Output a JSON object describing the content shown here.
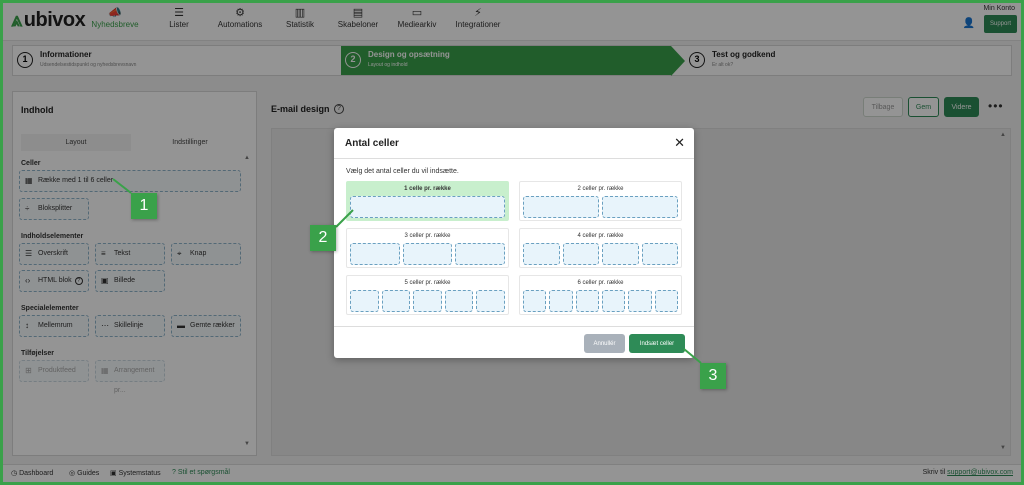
{
  "app": {
    "logo": "ubivox",
    "nav": [
      {
        "label": "Nyhedsbreve",
        "icon": "megaphone-icon",
        "glyph": "📣",
        "active": true
      },
      {
        "label": "Lister",
        "icon": "list-icon",
        "glyph": "☰",
        "active": false
      },
      {
        "label": "Automations",
        "icon": "gears-icon",
        "glyph": "⚙",
        "active": false
      },
      {
        "label": "Statistik",
        "icon": "bar-chart-icon",
        "glyph": "▥",
        "active": false
      },
      {
        "label": "Skabeloner",
        "icon": "templates-icon",
        "glyph": "▤",
        "active": false
      },
      {
        "label": "Mediearkiv",
        "icon": "media-icon",
        "glyph": "▭",
        "active": false
      },
      {
        "label": "Integrationer",
        "icon": "plug-icon",
        "glyph": "⚡",
        "active": false
      }
    ],
    "account_label": "Min Konto",
    "support_label": "Support"
  },
  "stepper": [
    {
      "num": "1",
      "title": "Informationer",
      "sub": "Udsendelsestidspunkt og nyhedsbrevsnavn",
      "state": "done"
    },
    {
      "num": "2",
      "title": "Design og opsætning",
      "sub": "Layout og indhold",
      "state": "current"
    },
    {
      "num": "3",
      "title": "Test og godkend",
      "sub": "Er alt ok?",
      "state": "todo"
    }
  ],
  "left_panel": {
    "title": "Indhold",
    "tabs": [
      "Layout",
      "Indstillinger"
    ],
    "sections": {
      "cells": "Celler",
      "content": "Indholdselementer",
      "special": "Specialelementer",
      "addons": "Tilføjelser"
    },
    "blocks": {
      "row": "Række med 1 til 6 celler",
      "splitter": "Bloksplitter",
      "heading": "Overskrift",
      "text": "Tekst",
      "button": "Knap",
      "html": "HTML blok",
      "image": "Billede",
      "spacer": "Mellemrum",
      "divider": "Skillelinje",
      "saved": "Gemte rækker",
      "product": "Produktfeed",
      "event": "Arrangement pr..."
    }
  },
  "editor": {
    "title": "E-mail design",
    "back_label": "Tilbage",
    "save_label": "Gem",
    "next_label": "Videre",
    "more_label": "•••"
  },
  "footer": {
    "dashboard": "Dashboard",
    "guides": "Guides",
    "status": "Systemstatus",
    "question": "Stil et spørgsmål",
    "write_to": "Skriv til",
    "email": "support@ubivox.com"
  },
  "modal": {
    "title": "Antal celler",
    "close": "✕",
    "instruction": "Vælg det antal celler du vil indsætte.",
    "options": [
      {
        "label": "1 celle pr. række",
        "cells": 1,
        "selected": true
      },
      {
        "label": "2 celler pr. række",
        "cells": 2,
        "selected": false
      },
      {
        "label": "3 celler pr. række",
        "cells": 3,
        "selected": false
      },
      {
        "label": "4 celler pr. række",
        "cells": 4,
        "selected": false
      },
      {
        "label": "5 celler pr. række",
        "cells": 5,
        "selected": false
      },
      {
        "label": "6 celler pr. række",
        "cells": 6,
        "selected": false
      }
    ],
    "cancel_label": "Annullér",
    "insert_label": "Indsæt celler"
  },
  "callouts": [
    "1",
    "2",
    "3"
  ],
  "colors": {
    "brand_green": "#3aa14a",
    "button_green": "#2e8b57",
    "cell_blue": "#e8f4fb",
    "selected_green": "#c8efcd"
  }
}
